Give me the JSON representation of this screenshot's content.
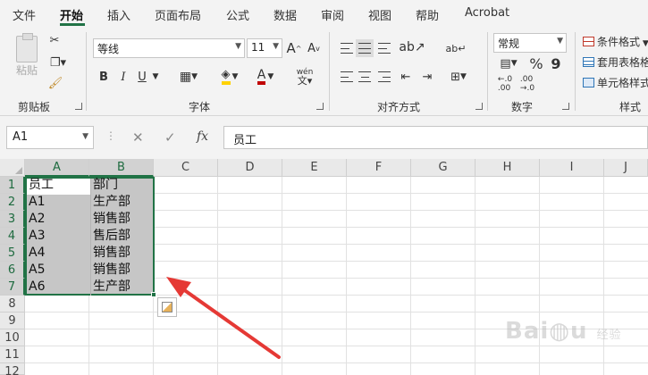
{
  "menu": {
    "tabs": [
      "文件",
      "开始",
      "插入",
      "页面布局",
      "公式",
      "数据",
      "审阅",
      "视图",
      "帮助",
      "Acrobat"
    ],
    "active": "开始"
  },
  "ribbon": {
    "clipboard": {
      "paste_label": "粘贴",
      "group_label": "剪贴板"
    },
    "font": {
      "name": "等线",
      "size": "11",
      "grow": "A",
      "shrink": "A",
      "bold": "B",
      "italic": "I",
      "underline": "U",
      "group_label": "字体",
      "font_color": "#c00000",
      "fill_color": "#ffd200",
      "phonetic": "wén"
    },
    "alignment": {
      "group_label": "对齐方式"
    },
    "number": {
      "format": "常规",
      "percent": "%",
      "comma": "9",
      "group_label": "数字"
    },
    "styles": {
      "conditional": "条件格式",
      "table": "套用表格格",
      "cell": "单元格样式",
      "group_label": "样式"
    }
  },
  "formula_bar": {
    "name_box": "A1",
    "fx": "fx",
    "content": "员工"
  },
  "sheet": {
    "columns": [
      "A",
      "B",
      "C",
      "D",
      "E",
      "F",
      "G",
      "H",
      "I",
      "J"
    ],
    "rows": [
      "1",
      "2",
      "3",
      "4",
      "5",
      "6",
      "7",
      "8",
      "9",
      "10",
      "11",
      "12"
    ],
    "cells": [
      [
        "员工",
        "部门"
      ],
      [
        "A1",
        "生产部"
      ],
      [
        "A2",
        "销售部"
      ],
      [
        "A3",
        "售后部"
      ],
      [
        "A4",
        "销售部"
      ],
      [
        "A5",
        "销售部"
      ],
      [
        "A6",
        "生产部"
      ]
    ],
    "accent_color": "#217346"
  },
  "annotation": {
    "arrow_color": "#e53935"
  },
  "watermark": {
    "text": "Bai",
    "suffix": "经验"
  }
}
